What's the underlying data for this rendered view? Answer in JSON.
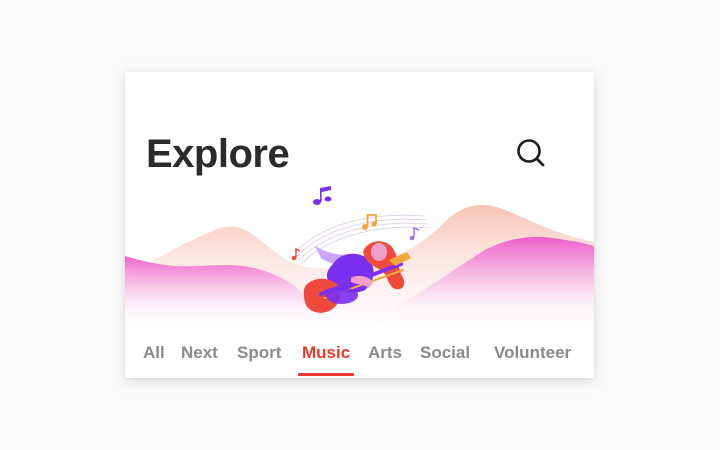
{
  "header": {
    "title": "Explore"
  },
  "icons": {
    "search": "search-icon",
    "hero": "music-illustration"
  },
  "tabs": [
    {
      "label": "All",
      "active": false
    },
    {
      "label": "Next",
      "active": false
    },
    {
      "label": "Sport",
      "active": false
    },
    {
      "label": "Music",
      "active": true
    },
    {
      "label": "Arts",
      "active": false
    },
    {
      "label": "Social",
      "active": false
    },
    {
      "label": "Volunteer",
      "active": false
    }
  ],
  "colors": {
    "accent": "#e8382f",
    "title": "#2b2b2b",
    "tab_inactive": "#8a8a8a",
    "wave_pink": "#f06fd0",
    "wave_peach": "#f8c9b8",
    "figure_purple": "#7b2ff0",
    "figure_red": "#f04a3c",
    "note_orange": "#f0a73c"
  }
}
